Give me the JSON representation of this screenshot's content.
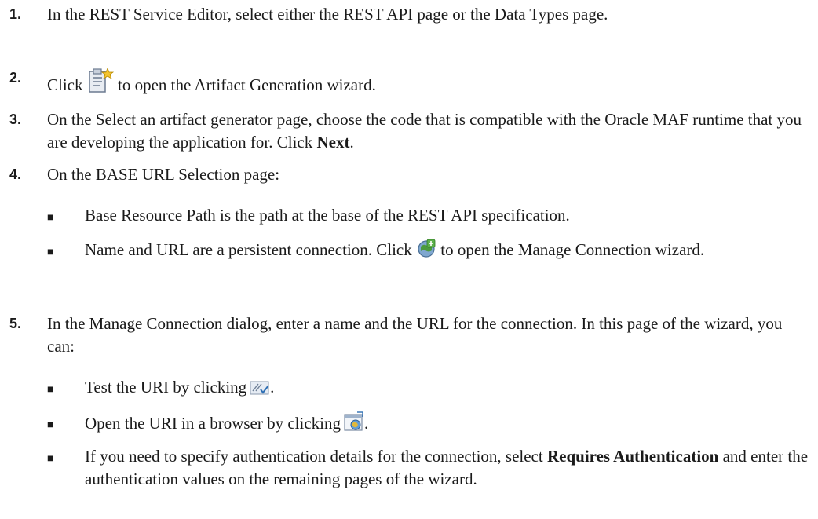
{
  "steps": [
    {
      "number": "1.",
      "text": "In the REST Service Editor, select either the REST API page or the Data Types page."
    },
    {
      "number": "2.",
      "pre": "Click",
      "post": "to open the Artifact Generation wizard.",
      "icon": "generate-artifact-icon"
    },
    {
      "number": "3.",
      "pre": "On the Select an artifact generator page, choose the code that is compatible with the Oracle MAF runtime that you are developing the application for. Click",
      "bold": "Next",
      "post": "."
    },
    {
      "number": "4.",
      "text": "On the BASE URL Selection page:",
      "bullets": [
        {
          "text": "Base Resource Path is the path at the base of the REST API specification."
        },
        {
          "pre": "Name and URL are a persistent connection. Click",
          "post": "to open the Manage Connection wizard.",
          "icon": "add-connection-icon"
        }
      ]
    },
    {
      "number": "5.",
      "text": "In the Manage Connection dialog, enter a name and the URL for the connection. In this page of the wizard, you can:",
      "bullets": [
        {
          "pre": "Test the URI by clicking",
          "post": ".",
          "icon": "test-uri-icon"
        },
        {
          "pre": "Open the URI in a browser by clicking",
          "post": ".",
          "icon": "open-browser-icon"
        },
        {
          "pre": "If you need to specify authentication details for the connection, select",
          "bold": "Requires Authentication",
          "post": "and enter the authentication values on the remaining pages of the wizard."
        }
      ]
    }
  ],
  "bullet_glyph": "■"
}
